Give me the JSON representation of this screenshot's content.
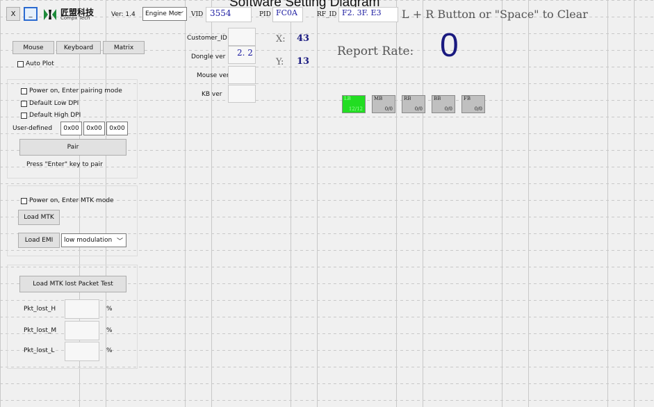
{
  "window_title": "Software Setting Diagram",
  "topbar": {
    "close_label": "X",
    "minimize_label": "_",
    "logo_cn": "匠盟科技",
    "logo_en": "Compx Tech",
    "version": "Ver: 1.4",
    "mode_select": "Engine Moc",
    "vid_label": "VID",
    "vid_value": "3554",
    "pid_label": "PID",
    "pid_value": "FC0A",
    "rfid_label": "RF_ID",
    "rfid_value": "F2. 3F. E3",
    "clear_hint": "L + R Button or \"Space\" to Clear"
  },
  "tabs": [
    "Mouse",
    "Keyboard",
    "Matrix"
  ],
  "auto_plot": "Auto Plot",
  "pairing": {
    "power_on_pair": "Power on, Enter pairing mode",
    "low_dpi": "Default Low DPI",
    "high_dpi": "Default High DPI",
    "user_defined": "User-defined",
    "hex1": "0x00",
    "hex2": "0x00",
    "hex3": "0x00",
    "pair_button": "Pair",
    "pair_hint": "Press \"Enter\" key to pair"
  },
  "mtk": {
    "power_on_mtk": "Power on, Enter MTK mode",
    "load_mtk": "Load MTK",
    "load_emi": "Load EMI",
    "emi_select": "low modulation"
  },
  "packet": {
    "test_button": "Load MTK lost Packet Test",
    "h_label": "Pkt_lost_H",
    "m_label": "Pkt_lost_M",
    "l_label": "Pkt_lost_L",
    "unit": "%"
  },
  "info": {
    "customer_id": "Customer_ID",
    "dongle_ver": "Dongle ver",
    "dongle_value": "2. 2",
    "mouse_ver": "Mouse ver",
    "kb_ver": "KB ver"
  },
  "coords": {
    "x_label": "X:",
    "x_value": "43",
    "y_label": "Y:",
    "y_value": "13"
  },
  "report": {
    "label": "Report Rate:",
    "value": "0"
  },
  "buttons": [
    {
      "name": "LB",
      "value": "12/12",
      "active": true
    },
    {
      "name": "MB",
      "value": "0/0",
      "active": false
    },
    {
      "name": "RB",
      "value": "0/0",
      "active": false
    },
    {
      "name": "BB",
      "value": "0/0",
      "active": false
    },
    {
      "name": "FB",
      "value": "0/0",
      "active": false
    }
  ],
  "colors": {
    "active_button": "#22dd22",
    "value_text": "#1a1aa0"
  }
}
